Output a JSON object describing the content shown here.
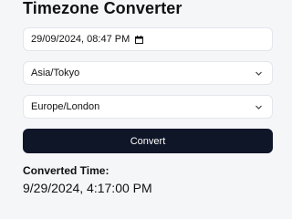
{
  "header": {
    "title": "Timezone Converter"
  },
  "form": {
    "datetime_value": "29/09/2024, 08:47 PM",
    "from_timezone": "Asia/Tokyo",
    "to_timezone": "Europe/London",
    "convert_label": "Convert"
  },
  "result": {
    "label": "Converted Time:",
    "value": "9/29/2024, 4:17:00 PM"
  },
  "icons": {
    "datetime": "calendar-icon",
    "select": "chevron-down-icon"
  },
  "colors": {
    "background": "#f5f6f8",
    "button": "#0f1628",
    "button_text": "#ffffff",
    "field_border": "#e3e6eb"
  }
}
